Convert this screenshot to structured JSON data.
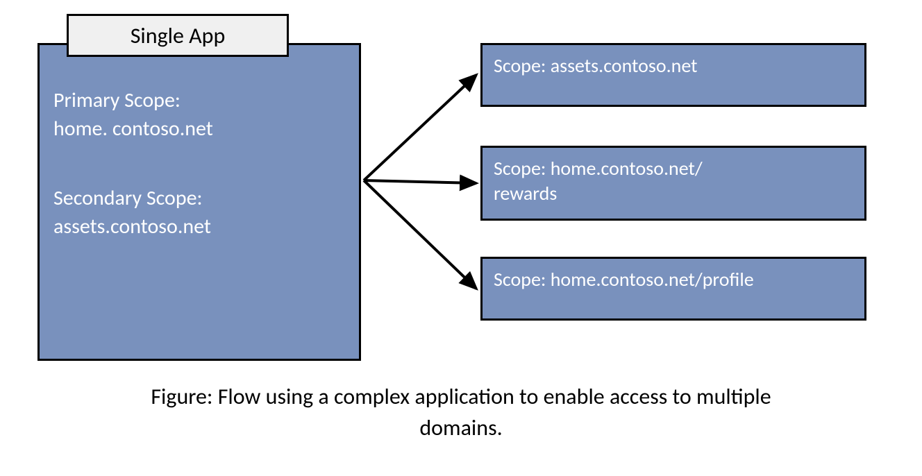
{
  "titleTab": "Single App",
  "mainBox": {
    "primaryLabel": "Primary Scope:",
    "primaryValue": "home. contoso.net",
    "secondaryLabel": "Secondary Scope:",
    "secondaryValue": "assets.contoso.net"
  },
  "scopes": [
    "Scope: assets.contoso.net",
    "Scope: home.contoso.net/\nrewards",
    "Scope: home.contoso.net/profile"
  ],
  "caption": "Figure: Flow using a complex application to enable access to multiple domains.",
  "colors": {
    "boxFill": "#7991bd",
    "tabFill": "#f0f0f0",
    "border": "#000000"
  }
}
